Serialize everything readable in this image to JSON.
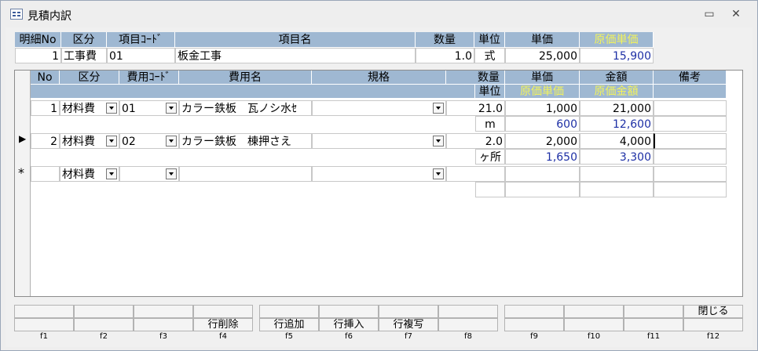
{
  "window": {
    "title": "見積内訳",
    "minimize_glyph": "▭",
    "close_glyph": "✕"
  },
  "detail_header": {
    "columns": [
      "明細No",
      "区分",
      "項目ｺｰﾄﾞ",
      "項目名",
      "数量",
      "単位",
      "単価",
      "原価単価"
    ],
    "row": {
      "no": "1",
      "kubun": "工事費",
      "code": "01",
      "name": "板金工事",
      "qty": "1.0",
      "unit": "式",
      "price": "25,000",
      "cost_price": "15,900"
    }
  },
  "lines": {
    "columns": [
      "No",
      "区分",
      "費用ｺｰﾄﾞ",
      "費用名",
      "規格",
      "数量",
      "単価",
      "金額",
      "備考"
    ],
    "subcolumns": {
      "unit": "単位",
      "cost_price": "原価単価",
      "cost_amount": "原価金額"
    },
    "rows": [
      {
        "no": "1",
        "kubun": "材料費",
        "code": "01",
        "name": "カラー鉄板　瓦ノシ水ｾ",
        "spec": "",
        "qty": "21.0",
        "price": "1,000",
        "amount": "21,000",
        "unit": "m",
        "cost_price": "600",
        "cost_amount": "12,600",
        "note": ""
      },
      {
        "no": "2",
        "kubun": "材料費",
        "code": "02",
        "name": "カラー鉄板　棟押さえ",
        "spec": "",
        "qty": "2.0",
        "price": "2,000",
        "amount": "4,000",
        "unit": "ヶ所",
        "cost_price": "1,650",
        "cost_amount": "3,300",
        "note": ""
      }
    ],
    "new_row": {
      "marker": "*",
      "kubun": "材料費"
    },
    "current_marker": "▶"
  },
  "function_keys": [
    {
      "key": "f1",
      "top": "",
      "bottom": ""
    },
    {
      "key": "f2",
      "top": "",
      "bottom": ""
    },
    {
      "key": "f3",
      "top": "",
      "bottom": ""
    },
    {
      "key": "f4",
      "top": "",
      "bottom": "行削除"
    },
    {
      "key": "f5",
      "top": "",
      "bottom": "行追加"
    },
    {
      "key": "f6",
      "top": "",
      "bottom": "行挿入"
    },
    {
      "key": "f7",
      "top": "",
      "bottom": "行複写"
    },
    {
      "key": "f8",
      "top": "",
      "bottom": ""
    },
    {
      "key": "f9",
      "top": "",
      "bottom": ""
    },
    {
      "key": "f10",
      "top": "",
      "bottom": ""
    },
    {
      "key": "f11",
      "top": "",
      "bottom": ""
    },
    {
      "key": "f12",
      "top": "閉じる",
      "bottom": ""
    }
  ]
}
